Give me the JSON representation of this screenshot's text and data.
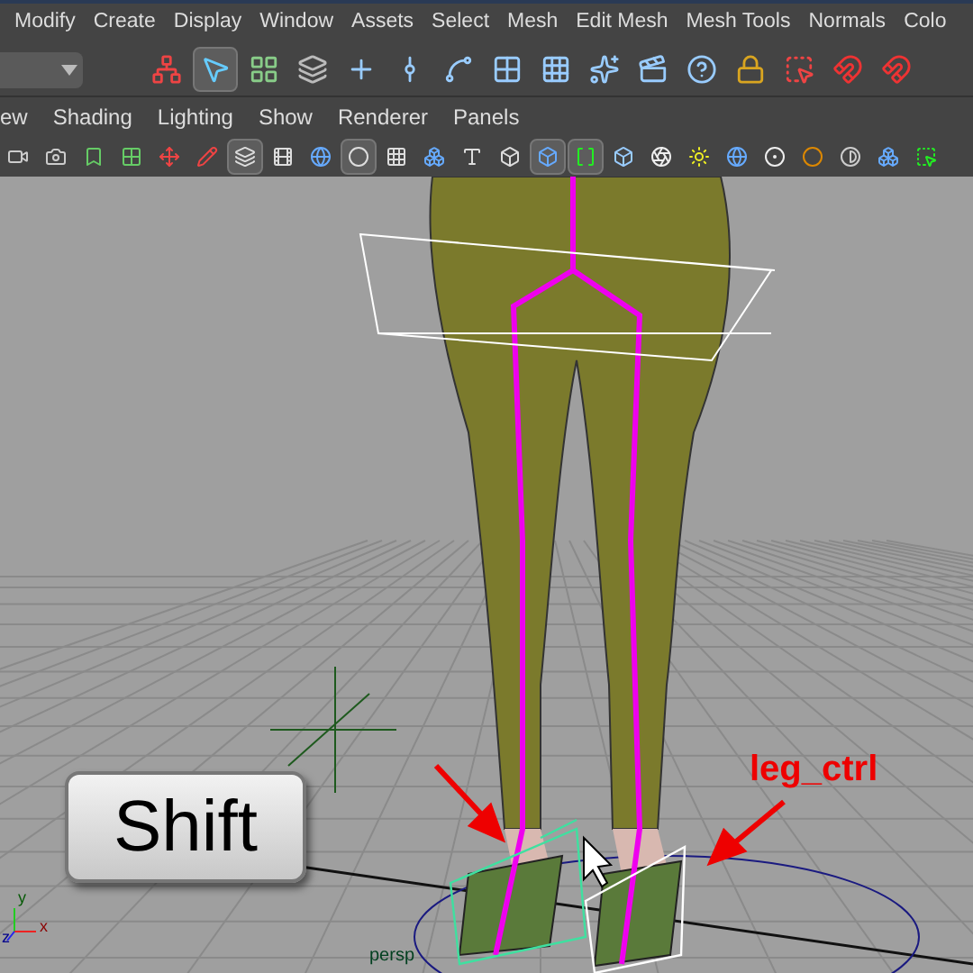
{
  "menu_bar": [
    "Modify",
    "Create",
    "Display",
    "Window",
    "Assets",
    "Select",
    "Mesh",
    "Edit Mesh",
    "Mesh Tools",
    "Normals",
    "Colo"
  ],
  "status_line_tools": [
    {
      "selected": false
    },
    {
      "selected": true
    },
    {
      "selected": false
    },
    {
      "selected": false
    },
    {
      "selected": false
    },
    {
      "selected": false
    },
    {
      "selected": false
    },
    {
      "selected": false
    },
    {
      "selected": false
    },
    {
      "selected": false
    },
    {
      "selected": false
    },
    {
      "selected": false
    },
    {
      "selected": false
    },
    {
      "selected": false
    },
    {
      "selected": false
    },
    {
      "selected": false
    }
  ],
  "panel_menu": [
    "ew",
    "Shading",
    "Lighting",
    "Show",
    "Renderer",
    "Panels"
  ],
  "panel_tools": [
    {
      "selected": false
    },
    {
      "selected": false
    },
    {
      "selected": false
    },
    {
      "selected": false
    },
    {
      "selected": false
    },
    {
      "selected": false
    },
    {
      "selected": true
    },
    {
      "selected": false
    },
    {
      "selected": false
    },
    {
      "selected": true
    },
    {
      "selected": false
    },
    {
      "selected": false
    },
    {
      "selected": false
    },
    {
      "selected": false
    },
    {
      "selected": true
    },
    {
      "selected": true
    },
    {
      "selected": false
    },
    {
      "selected": false
    },
    {
      "selected": false
    },
    {
      "selected": false
    },
    {
      "selected": false
    },
    {
      "selected": false
    },
    {
      "selected": false
    },
    {
      "selected": false
    },
    {
      "selected": false
    }
  ],
  "viewport": {
    "key_label": "Shift",
    "callout": "leg_ctrl",
    "camera_label": "persp",
    "axis_labels": [
      "y",
      "z",
      "x"
    ]
  }
}
